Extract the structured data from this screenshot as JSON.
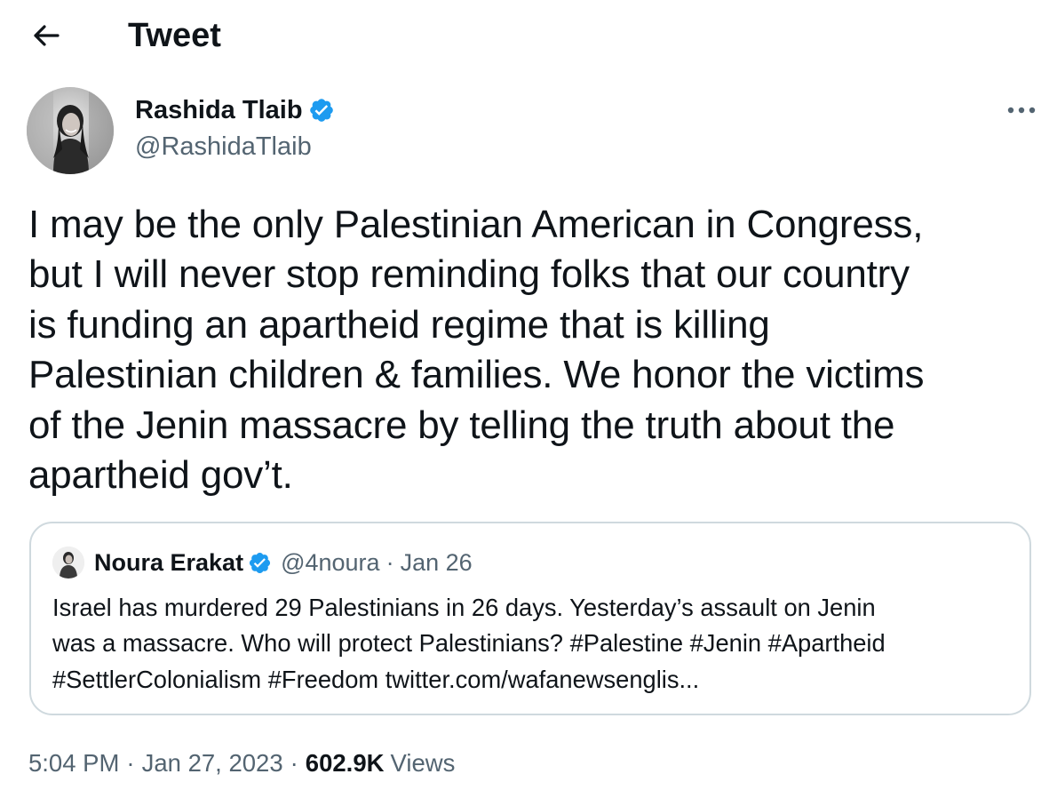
{
  "header": {
    "title": "Tweet",
    "back_icon": "arrow-left-icon"
  },
  "author": {
    "name": "Rashida Tlaib",
    "handle": "@RashidaTlaib",
    "verified_icon": "verified-badge-icon",
    "more_icon": "more-horizontal-icon"
  },
  "tweet": {
    "lines": [
      "I may be the only Palestinian American in Congress,",
      "but I will never stop reminding folks that our country",
      "is funding an apartheid regime that is killing",
      "Palestinian children & families. We honor the victims",
      "of the Jenin massacre by telling the truth about the",
      "apartheid gov’t."
    ]
  },
  "quote": {
    "name": "Noura Erakat",
    "handle": "@4noura",
    "separator": "·",
    "date": "Jan 26",
    "lines": [
      "Israel has murdered 29 Palestinians in 26 days. Yesterday’s assault on Jenin",
      "was a massacre. Who will protect Palestinians? #Palestine #Jenin #Apartheid",
      "#SettlerColonialism #Freedom twitter.com/wafanewsenglis..."
    ]
  },
  "meta": {
    "time": "5:04 PM",
    "separator": "·",
    "date": "Jan 27, 2023",
    "views_count": "602.9K",
    "views_label": "Views"
  },
  "colors": {
    "text_primary": "#0f1419",
    "text_secondary": "#536471",
    "verified_blue": "#1d9bf0",
    "border": "#cfd9de"
  }
}
